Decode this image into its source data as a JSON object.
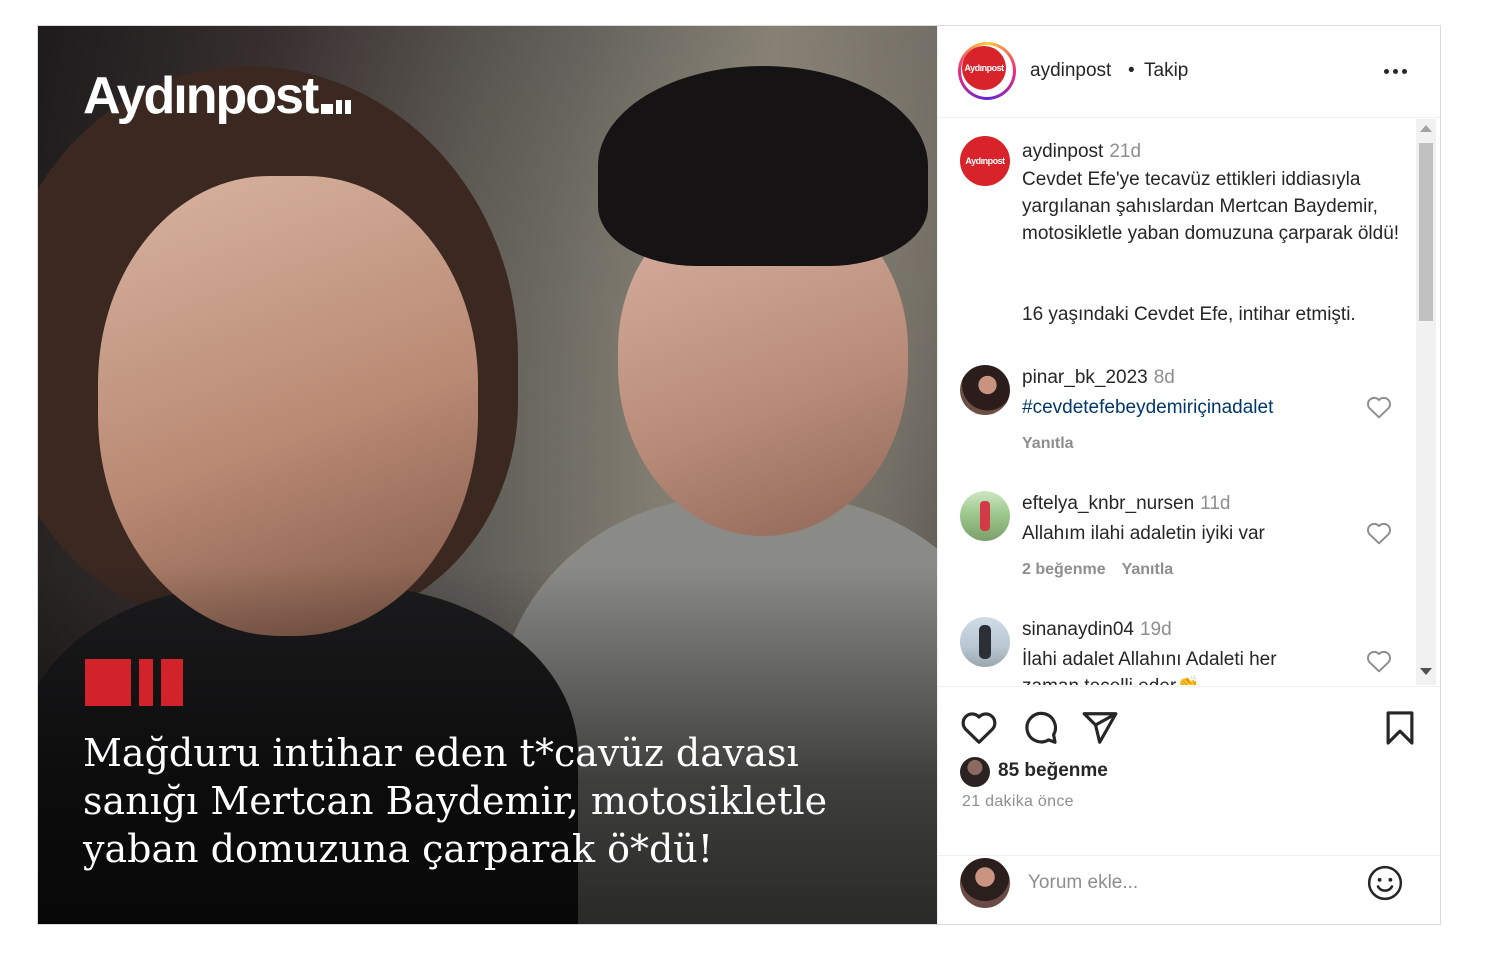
{
  "media": {
    "brand_name": "Aydınpost",
    "headline": "Mağduru intihar eden t*cavüz davası sanığı Mertcan Baydemir, motosikletle yaban domuzuna çarparak ö*dü!",
    "accent_color": "#d2232a"
  },
  "header": {
    "username": "aydinpost",
    "separator": "•",
    "follow_label": "Takip",
    "avatar_text": "Aydınpost"
  },
  "caption": {
    "username": "aydinpost",
    "time": "21d",
    "text_line1": "Cevdet Efe'ye tecavüz ettikleri iddiasıyla yargılanan şahıslardan Mertcan Baydemir, motosikletle yaban domuzuna çarparak öldü!",
    "text_line2": "16 yaşındaki Cevdet Efe, intihar etmişti."
  },
  "comments": [
    {
      "username": "pinar_bk_2023",
      "time": "8d",
      "text": "#cevdetefebeydemiriçinadalet",
      "reply_label": "Yanıtla"
    },
    {
      "username": "eftelya_knbr_nursen",
      "time": "11d",
      "text": "Allahım ilahi adaletin iyiki var",
      "likes_label": "2 beğenme",
      "reply_label": "Yanıtla"
    },
    {
      "username": "sinanaydin04",
      "time": "19d",
      "text": "İlahi adalet Allahını Adaleti her zaman tecelli eder👏"
    }
  ],
  "actions": {
    "likes_text": "85 beğenme",
    "posted_time": "21 dakika önce",
    "comment_placeholder": "Yorum ekle..."
  },
  "icons": [
    "more-icon",
    "heart-icon",
    "comment-icon",
    "share-icon",
    "bookmark-icon",
    "emoji-icon",
    "heart-small-icon"
  ]
}
